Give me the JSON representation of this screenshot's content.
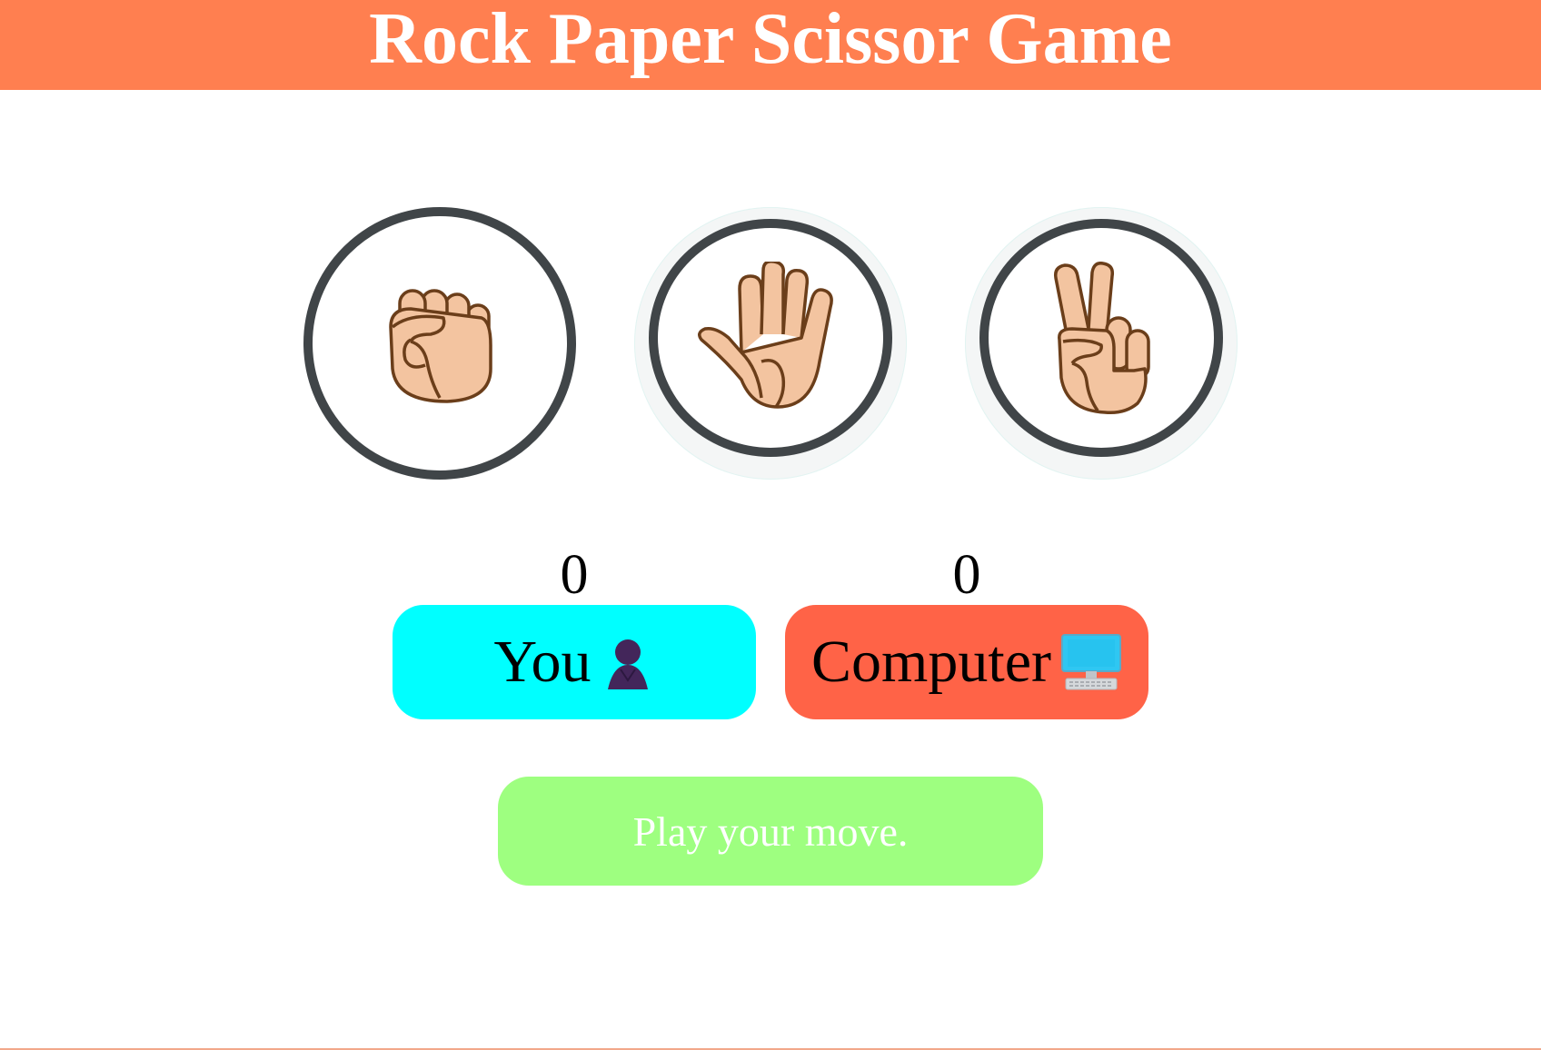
{
  "header": {
    "title": "Rock Paper Scissor Game"
  },
  "choices": [
    {
      "name": "rock",
      "icon": "raised-fist-icon"
    },
    {
      "name": "paper",
      "icon": "raised-hand-icon"
    },
    {
      "name": "scissors",
      "icon": "victory-hand-icon"
    }
  ],
  "scoreboard": {
    "user": {
      "score": "0",
      "label": "You",
      "icon": "person-silhouette-icon",
      "color": "#00ffff"
    },
    "computer": {
      "score": "0",
      "label": "Computer",
      "icon": "desktop-computer-icon",
      "color": "#ff6347"
    }
  },
  "message": {
    "text": "Play your move.",
    "color": "#9eff80"
  },
  "colors": {
    "header": "#ff7f50",
    "ring": "#404548",
    "skin": "#f3c4a0",
    "outline": "#6b3e1a"
  }
}
